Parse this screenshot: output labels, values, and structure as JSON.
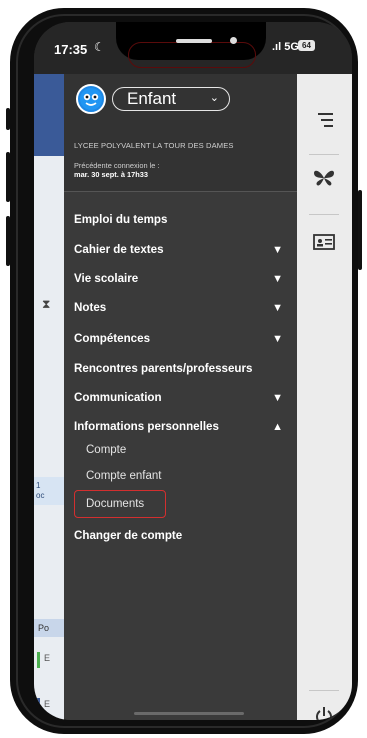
{
  "status_bar": {
    "time": "17:35",
    "network": "5G",
    "battery": "64"
  },
  "background_app": {
    "card_text_line1": "1",
    "card_text_line2": "oc",
    "strip_label": "Po",
    "row1": "E",
    "row2": "E"
  },
  "drawer": {
    "child_selector": {
      "value": "Enfant"
    },
    "school_name": "LYCEE POLYVALENT LA TOUR DES DAMES",
    "last_login_label": "Précédente connexion le :",
    "last_login_date": "mar. 30 sept. à 17h33",
    "menu": [
      {
        "label": "Emploi du temps",
        "chevron": ""
      },
      {
        "label": "Cahier de textes",
        "chevron": "down"
      },
      {
        "label": "Vie scolaire",
        "chevron": "down"
      },
      {
        "label": "Notes",
        "chevron": "down"
      },
      {
        "label": "Compétences",
        "chevron": "down"
      },
      {
        "label": "Rencontres parents/professeurs",
        "chevron": ""
      },
      {
        "label": "Communication",
        "chevron": "down"
      },
      {
        "label": "Informations personnelles",
        "chevron": "up"
      }
    ],
    "submenu": [
      "Compte",
      "Compte enfant",
      "Documents"
    ],
    "switch_account": "Changer de compte"
  },
  "rail": {
    "icons": [
      "menu-icon",
      "butterfly-icon",
      "id-card-icon",
      "power-icon"
    ]
  },
  "colors": {
    "drawer_bg": "#3a3a3a",
    "highlight_border": "#d32f2f",
    "rail_bg": "#ececec"
  }
}
